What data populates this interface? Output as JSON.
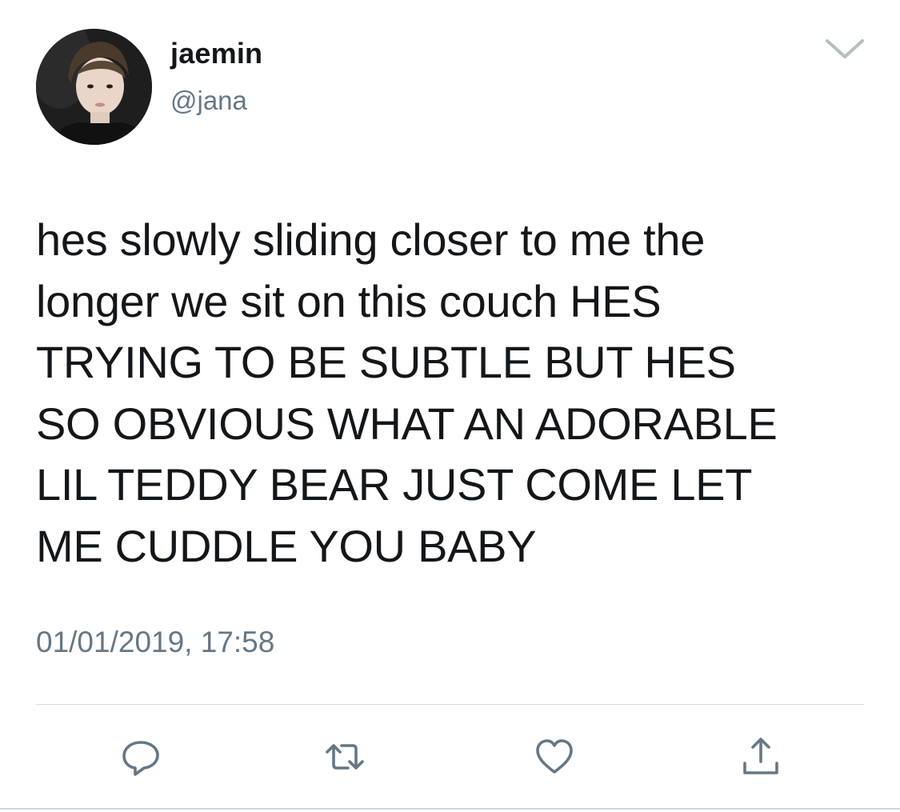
{
  "user": {
    "display_name": "jaemin",
    "handle": "@jana"
  },
  "tweet": {
    "text": "hes slowly sliding closer to me the\nlonger we sit on this couch HES\nTRYING TO BE SUBTLE BUT HES\nSO OBVIOUS WHAT AN ADORABLE\nLIL TEDDY BEAR JUST COME LET\nME CUDDLE YOU BABY",
    "timestamp": "01/01/2019, 17:58"
  },
  "icons": {
    "menu": "chevron-down-icon",
    "reply": "reply-icon",
    "retweet": "retweet-icon",
    "like": "heart-icon",
    "share": "share-icon"
  },
  "colors": {
    "text_primary": "#14171a",
    "text_secondary": "#657786",
    "icon_gray": "#657786",
    "divider": "#d8dde1"
  }
}
